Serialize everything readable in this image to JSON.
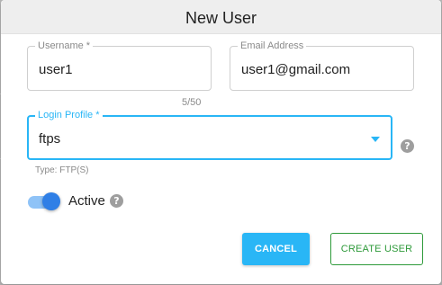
{
  "dialog": {
    "title": "New User"
  },
  "form": {
    "username": {
      "label": "Username *",
      "value": "user1",
      "counter": "5/50"
    },
    "email": {
      "label": "Email Address",
      "value": "user1@gmail.com"
    },
    "login_profile": {
      "label": "Login Profile *",
      "value": "ftps",
      "helper": "Type: FTP(S)"
    },
    "active": {
      "label": "Active",
      "on": true
    }
  },
  "actions": {
    "cancel_label": "CANCEL",
    "create_label": "CREATE USER"
  },
  "icons": {
    "help_glyph": "?"
  },
  "colors": {
    "accent": "#29b6f6",
    "toggle_on": "#2f7fe6",
    "create_green": "#2e9a3a"
  }
}
